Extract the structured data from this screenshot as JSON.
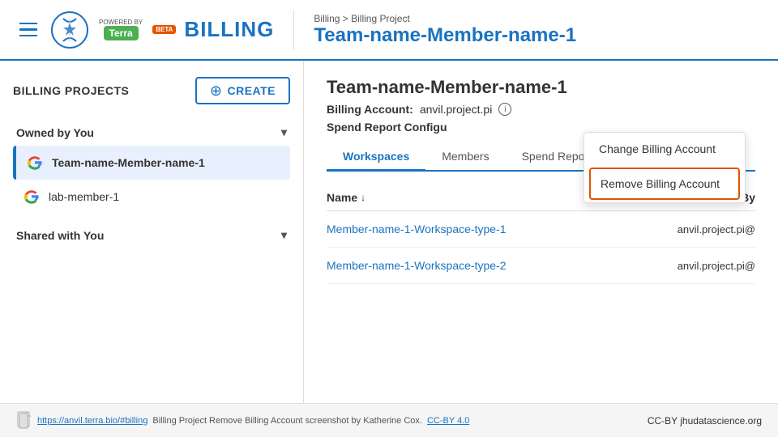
{
  "header": {
    "menu_label": "Menu",
    "powered_by": "POWERED BY",
    "terra": "Terra",
    "beta": "BETA",
    "billing": "BILLING",
    "breadcrumb_top": "Billing > Billing Project",
    "breadcrumb_title": "Team-name-Member-name-1"
  },
  "sidebar": {
    "billing_projects_label": "BILLING PROJECTS",
    "create_button": "CREATE",
    "owned_by_you": "Owned by You",
    "shared_with_you": "Shared with You",
    "projects": [
      {
        "name": "Team-name-Member-name-1",
        "active": true
      },
      {
        "name": "lab-member-1",
        "active": false
      }
    ]
  },
  "content": {
    "project_title": "Team-name-Member-name-1",
    "billing_account_label": "Billing Account:",
    "billing_account_value": "anvil.project.pi",
    "spend_report_label": "Spend Report Configu",
    "dropdown": {
      "change_billing": "Change Billing Account",
      "remove_billing": "Remove Billing Account"
    },
    "tabs": [
      {
        "label": "Workspaces",
        "active": true
      },
      {
        "label": "Members",
        "active": false
      },
      {
        "label": "Spend Report",
        "active": false
      }
    ],
    "table": {
      "col_name": "Name",
      "col_created": "Created By",
      "rows": [
        {
          "name": "Member-name-1-Workspace-type-1",
          "created": "anvil.project.pi@"
        },
        {
          "name": "Member-name-1-Workspace-type-2",
          "created": "anvil.project.pi@"
        }
      ]
    }
  },
  "footer": {
    "link_text": "https://anvil.terra.bio/#billing",
    "description": "Billing Project Remove Billing Account screenshot by Katherine Cox.",
    "license": "CC-BY 4.0",
    "right_text": "CC-BY  jhudatascience.org"
  }
}
